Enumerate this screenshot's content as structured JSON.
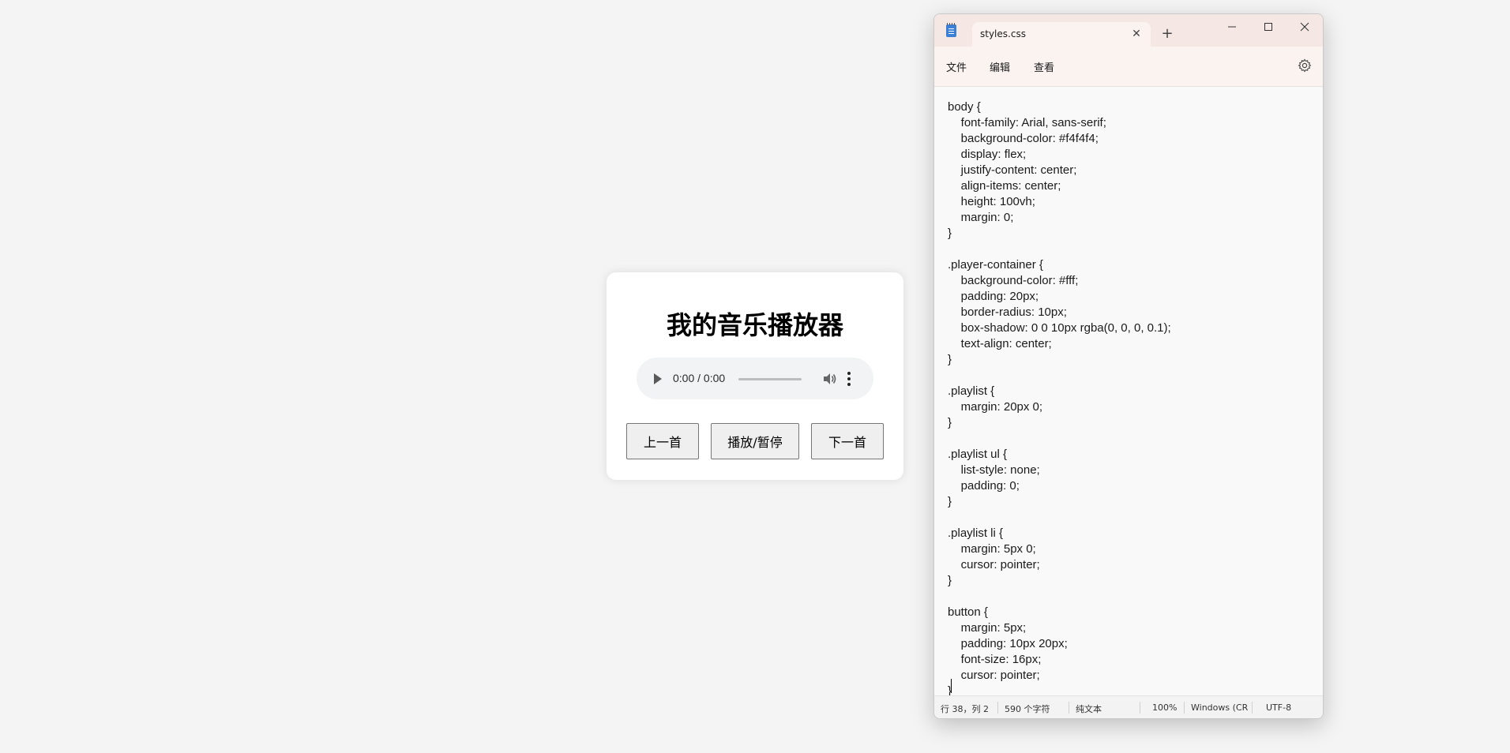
{
  "player": {
    "title": "我的音乐播放器",
    "audio": {
      "time": "0:00 / 0:00"
    },
    "buttons": {
      "prev": "上一首",
      "play_pause": "播放/暂停",
      "next": "下一首"
    }
  },
  "notepad": {
    "tab_title": "styles.css",
    "menu": {
      "file": "文件",
      "edit": "编辑",
      "view": "查看"
    },
    "content": "body {\n    font-family: Arial, sans-serif;\n    background-color: #f4f4f4;\n    display: flex;\n    justify-content: center;\n    align-items: center;\n    height: 100vh;\n    margin: 0;\n}\n\n.player-container {\n    background-color: #fff;\n    padding: 20px;\n    border-radius: 10px;\n    box-shadow: 0 0 10px rgba(0, 0, 0, 0.1);\n    text-align: center;\n}\n\n.playlist {\n    margin: 20px 0;\n}\n\n.playlist ul {\n    list-style: none;\n    padding: 0;\n}\n\n.playlist li {\n    margin: 5px 0;\n    cursor: pointer;\n}\n\nbutton {\n    margin: 5px;\n    padding: 10px 20px;\n    font-size: 16px;\n    cursor: pointer;\n}",
    "status": {
      "position": "行 38，列 2",
      "chars": "590 个字符",
      "format": "纯文本",
      "zoom": "100%",
      "line_ending": "Windows (CR",
      "encoding": "UTF-8"
    },
    "colors": {
      "titlebar": "#f5e8e4",
      "menubar": "#fbf3f0",
      "editor_bg": "#f9f9f9",
      "app_icon": "#3b7fd6"
    }
  }
}
